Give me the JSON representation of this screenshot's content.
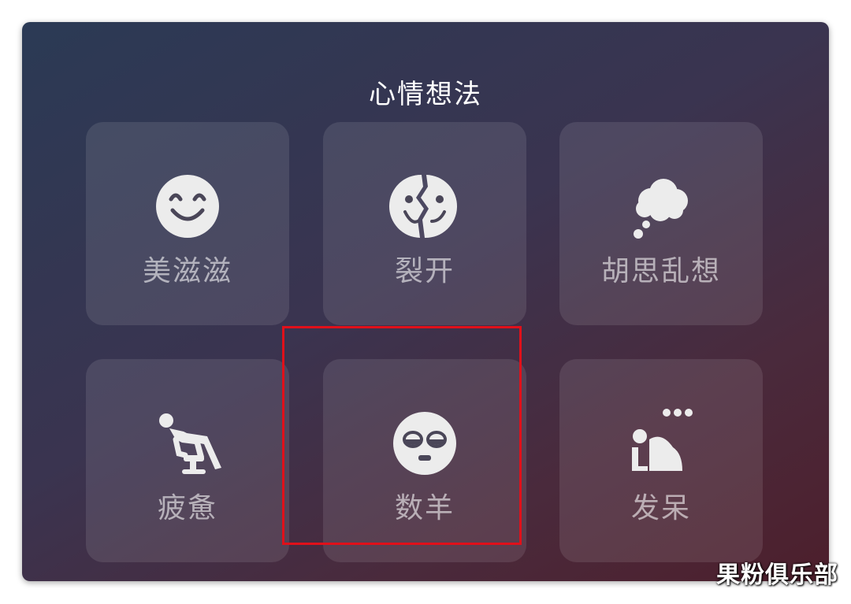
{
  "panel": {
    "title": "心情想法"
  },
  "tiles": [
    {
      "label": "美滋滋",
      "icon": "smile-icon"
    },
    {
      "label": "裂开",
      "icon": "cracked-face-icon"
    },
    {
      "label": "胡思乱想",
      "icon": "thought-cloud-icon"
    },
    {
      "label": "疲惫",
      "icon": "slumped-person-icon"
    },
    {
      "label": "数羊",
      "icon": "sleepy-face-icon"
    },
    {
      "label": "发呆",
      "icon": "daydream-person-icon"
    }
  ],
  "highlight": {
    "color": "#e0101a"
  },
  "watermark": {
    "text": "果粉俱乐部"
  }
}
